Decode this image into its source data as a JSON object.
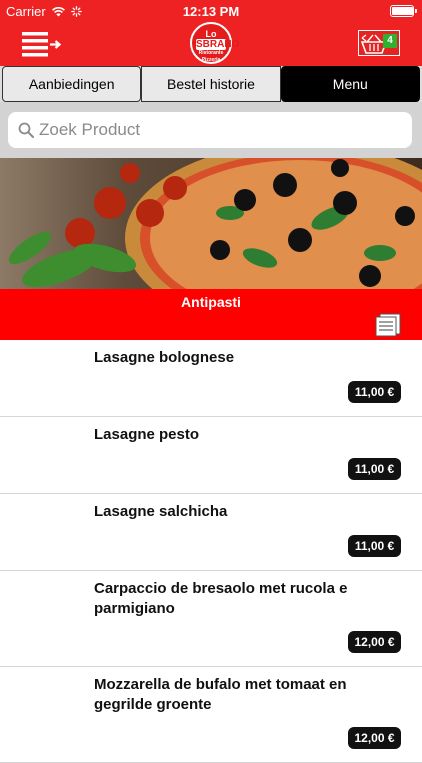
{
  "status_bar": {
    "carrier": "Carrier",
    "time": "12:13 PM",
    "battery_level": 0.95
  },
  "header": {
    "logo": {
      "line1": "Lo",
      "line2": "SBRANO",
      "line3": "Ristorante Pizzeria"
    },
    "cart_count": "4"
  },
  "tabs": [
    {
      "label": "Aanbiedingen",
      "active": false
    },
    {
      "label": "Bestel historie",
      "active": false
    },
    {
      "label": "Menu",
      "active": true
    }
  ],
  "search": {
    "placeholder": "Zoek Product"
  },
  "category": {
    "title": "Antipasti"
  },
  "products": [
    {
      "name": "Lasagne bolognese",
      "price": "11,00 €"
    },
    {
      "name": "Lasagne pesto",
      "price": "11,00 €"
    },
    {
      "name": "Lasagne salchicha",
      "price": "11,00 €"
    },
    {
      "name": "Carpaccio de bresaolo met rucola e parmigiano",
      "price": "12,00 €"
    },
    {
      "name": "Mozzarella de bufalo met tomaat en gegrilde groente",
      "price": "12,00 €"
    }
  ],
  "colors": {
    "brand_red": "#ee2222",
    "category_red": "#ff0000",
    "badge_green": "#2fb12f",
    "price_bg": "#111111"
  }
}
